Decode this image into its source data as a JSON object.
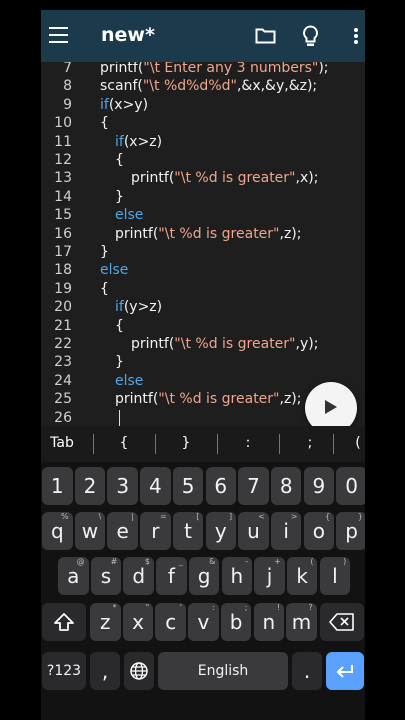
{
  "app": {
    "title": "new*"
  },
  "icons": {
    "menu": "menu-icon",
    "folder": "folder-icon",
    "bulb": "lightbulb-icon",
    "more": "more-vert-icon",
    "run": "play-icon"
  },
  "colors": {
    "toolbar": "#1b3a4b",
    "keyword": "#4fa6e6",
    "string": "#f0a58c",
    "enter": "#5aa0ff"
  },
  "code_lines": [
    {
      "n": "7",
      "pre": "printf(",
      "str": "\"\\t Enter any 3 numbers\"",
      "post": ");",
      "indent": 0
    },
    {
      "n": "8",
      "pre": "scanf(",
      "str": "\"\\t %d%d%d\"",
      "post": ",&x,&y,&z);",
      "indent": 0
    },
    {
      "n": "9",
      "kw": "if",
      "post": "(x>y)",
      "indent": 0
    },
    {
      "n": "10",
      "post": "{",
      "indent": 0
    },
    {
      "n": "11",
      "kw": "if",
      "post": "(x>z)",
      "indent": 1
    },
    {
      "n": "12",
      "post": "{",
      "indent": 1
    },
    {
      "n": "13",
      "pre": "printf(",
      "str": "\"\\t %d is greater\"",
      "post": ",x);",
      "indent": 2
    },
    {
      "n": "14",
      "post": "}",
      "indent": 1
    },
    {
      "n": "15",
      "kw": "else",
      "indent": 1
    },
    {
      "n": "16",
      "pre": "printf(",
      "str": "\"\\t %d is greater\"",
      "post": ",z);",
      "indent": 1
    },
    {
      "n": "17",
      "post": "}",
      "indent": 0
    },
    {
      "n": "18",
      "kw": "else",
      "indent": 0
    },
    {
      "n": "19",
      "post": "{",
      "indent": 0
    },
    {
      "n": "20",
      "kw": "if",
      "post": "(y>z)",
      "indent": 1
    },
    {
      "n": "21",
      "post": "{",
      "indent": 1
    },
    {
      "n": "22",
      "pre": "printf(",
      "str": "\"\\t %d is greater\"",
      "post": ",y);",
      "indent": 2
    },
    {
      "n": "23",
      "post": "}",
      "indent": 1
    },
    {
      "n": "24",
      "kw": "else",
      "indent": 1
    },
    {
      "n": "25",
      "pre": "printf(",
      "str": "\"\\t %d is greater\"",
      "post": ",z);",
      "indent": 1
    },
    {
      "n": "26",
      "indent": 1
    }
  ],
  "symbols": [
    "Tab",
    "{",
    "}",
    ":",
    ";",
    "("
  ],
  "keyboard": {
    "row1": [
      "1",
      "2",
      "3",
      "4",
      "5",
      "6",
      "7",
      "8",
      "9",
      "0"
    ],
    "row2": [
      {
        "k": "q",
        "h": "%"
      },
      {
        "k": "w",
        "h": "\\"
      },
      {
        "k": "e",
        "h": "|"
      },
      {
        "k": "r",
        "h": "="
      },
      {
        "k": "t",
        "h": "["
      },
      {
        "k": "y",
        "h": "]"
      },
      {
        "k": "u",
        "h": "<"
      },
      {
        "k": "i",
        "h": ">"
      },
      {
        "k": "o",
        "h": "{"
      },
      {
        "k": "p",
        "h": "}"
      }
    ],
    "row3": [
      {
        "k": "a",
        "h": "@"
      },
      {
        "k": "s",
        "h": "#"
      },
      {
        "k": "d",
        "h": "$"
      },
      {
        "k": "f",
        "h": "_"
      },
      {
        "k": "g",
        "h": "&"
      },
      {
        "k": "h",
        "h": "-"
      },
      {
        "k": "j",
        "h": "+"
      },
      {
        "k": "k",
        "h": "("
      },
      {
        "k": "l",
        "h": ")"
      }
    ],
    "row4": [
      {
        "k": "z",
        "h": "*"
      },
      {
        "k": "x",
        "h": "\""
      },
      {
        "k": "c",
        "h": "'"
      },
      {
        "k": "v",
        "h": ":"
      },
      {
        "k": "b",
        "h": ";"
      },
      {
        "k": "n",
        "h": "!"
      },
      {
        "k": "m",
        "h": "?"
      }
    ],
    "symbols_key": "?123",
    "comma": ",",
    "space": "English",
    "period": "."
  }
}
